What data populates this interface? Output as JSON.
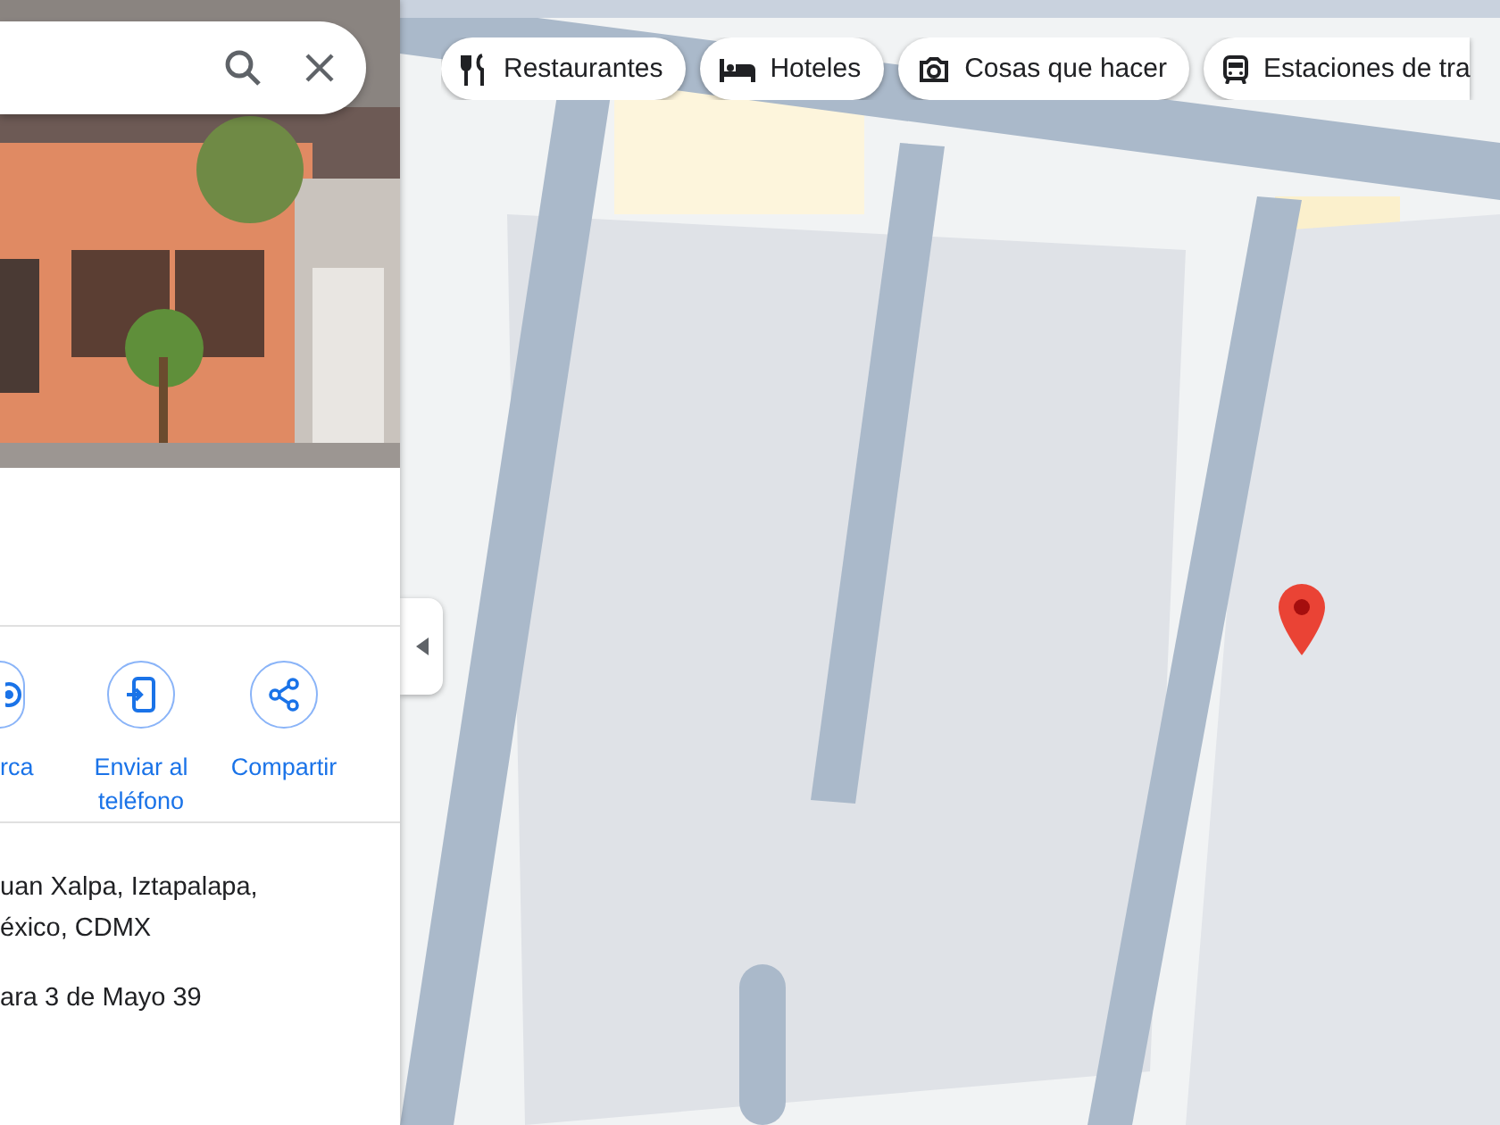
{
  "place_panel": {
    "actions": [
      {
        "kind": "nearby",
        "label": "rca"
      },
      {
        "kind": "send",
        "label": "Enviar al teléfono"
      },
      {
        "kind": "share",
        "label": "Compartir"
      }
    ],
    "address_lines": [
      "uan Xalpa, Iztapalapa,",
      "éxico, CDMX"
    ],
    "plus_code": "ara 3 de Mayo 39"
  },
  "map": {
    "chips": [
      {
        "kind": "restaurant",
        "label": "Restaurantes"
      },
      {
        "kind": "hotel",
        "label": "Hoteles"
      },
      {
        "kind": "camera",
        "label": "Cosas que hacer"
      },
      {
        "kind": "transit",
        "label": "Estaciones de tra"
      }
    ]
  }
}
